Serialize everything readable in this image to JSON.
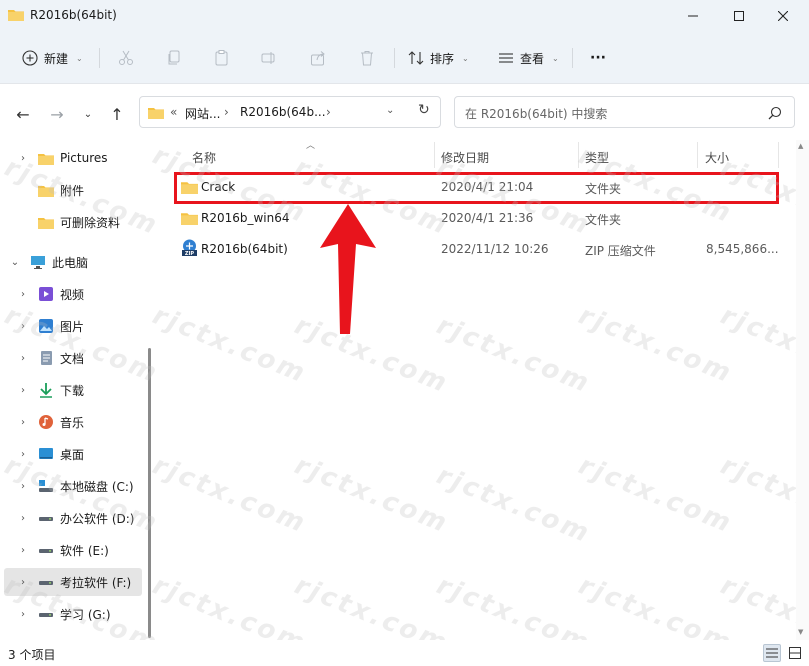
{
  "window": {
    "title": "R2016b(64bit)",
    "minimize_icon": "minimize-icon",
    "maximize_icon": "maximize-icon",
    "close_icon": "close-icon"
  },
  "toolbar": {
    "new_label": "新建",
    "sort_label": "排序",
    "view_label": "查看",
    "more_label": "···"
  },
  "address": {
    "prefix": "«",
    "crumbs": [
      "网站...",
      "R2016b(64b..."
    ],
    "search_placeholder": "在 R2016b(64bit) 中搜索"
  },
  "sidebar": {
    "items": [
      {
        "label": "Pictures",
        "icon": "folder-icon"
      },
      {
        "label": "附件",
        "icon": "folder-icon"
      },
      {
        "label": "可删除资料",
        "icon": "folder-icon"
      },
      {
        "label": "此电脑",
        "icon": "computer-icon"
      },
      {
        "label": "视频",
        "icon": "video-icon"
      },
      {
        "label": "图片",
        "icon": "image-icon"
      },
      {
        "label": "文档",
        "icon": "document-icon"
      },
      {
        "label": "下载",
        "icon": "download-icon"
      },
      {
        "label": "音乐",
        "icon": "music-icon"
      },
      {
        "label": "桌面",
        "icon": "desktop-icon"
      },
      {
        "label": "本地磁盘 (C:)",
        "icon": "drive-c-icon"
      },
      {
        "label": "办公软件 (D:)",
        "icon": "drive-icon"
      },
      {
        "label": "软件 (E:)",
        "icon": "drive-icon"
      },
      {
        "label": "考拉软件 (F:)",
        "icon": "drive-icon"
      },
      {
        "label": "学习 (G:)",
        "icon": "drive-icon"
      }
    ]
  },
  "columns": {
    "name": "名称",
    "modified": "修改日期",
    "type": "类型",
    "size": "大小"
  },
  "files": [
    {
      "name": "Crack",
      "modified": "2020/4/1 21:04",
      "type": "文件夹",
      "size": "",
      "icon": "folder-icon"
    },
    {
      "name": "R2016b_win64",
      "modified": "2020/4/1 21:36",
      "type": "文件夹",
      "size": "",
      "icon": "folder-icon"
    },
    {
      "name": "R2016b(64bit)",
      "modified": "2022/11/12 10:26",
      "type": "ZIP 压缩文件",
      "size": "8,545,866...",
      "icon": "zip-icon"
    }
  ],
  "status": {
    "count": "3 个项目"
  },
  "watermark": "rjctx.com",
  "colors": {
    "highlight": "#e8141c",
    "folder": "#f5c242",
    "arrow": "#e8141c"
  }
}
